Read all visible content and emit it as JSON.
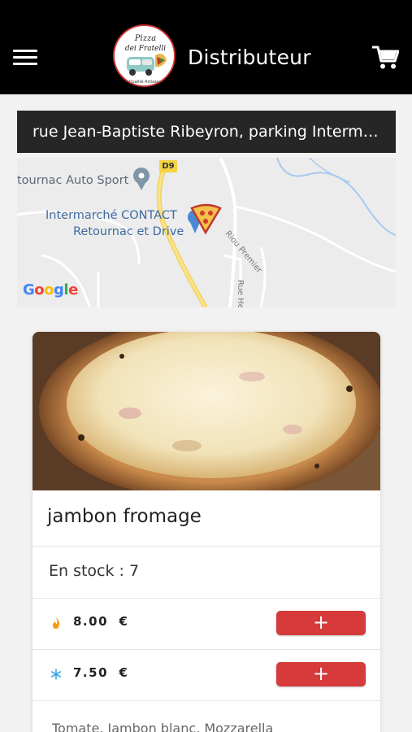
{
  "header": {
    "title": "Distributeur",
    "menu_icon": "hamburger-menu-icon",
    "cart_icon": "shopping-cart-icon",
    "logo_text": "Pizza dei Fratelli"
  },
  "location": {
    "address": "rue Jean-Baptiste Ribeyron, parking Interm…",
    "map": {
      "poi_label": "tournac Auto Sport",
      "store_line1": "Intermarché CONTACT",
      "store_line2": "Retournac et Drive",
      "road_badge": "D9",
      "road_label_1": "Riou Premier",
      "road_label_2": "Rue Her",
      "attribution": "Google"
    }
  },
  "product": {
    "name": "jambon fromage",
    "stock_text": "En stock : 7",
    "prices": [
      {
        "icon": "flame-icon",
        "value": "8.00",
        "currency": "€",
        "add_label": "+"
      },
      {
        "icon": "snowflake-icon",
        "value": "7.50",
        "currency": "€",
        "add_label": "+"
      }
    ],
    "description": "Tomate, Jambon blanc, Mozzarella"
  },
  "colors": {
    "header_bg": "#000000",
    "accent_red": "#d63a3a",
    "flame": "#f39c12",
    "snow": "#3aa7e0"
  }
}
